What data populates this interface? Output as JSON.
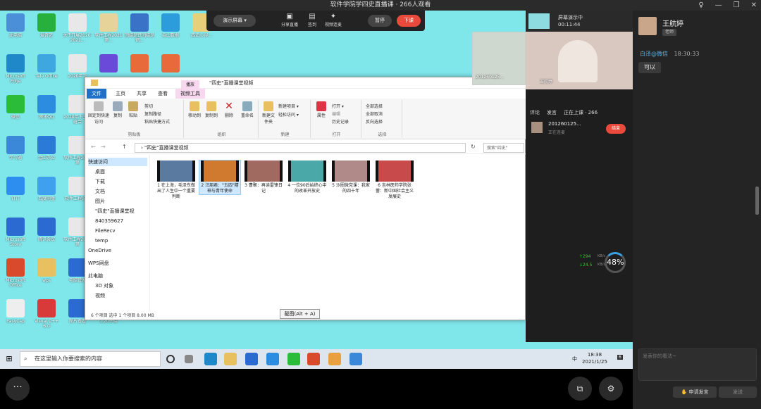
{
  "window": {
    "title": "软件学院学四史直播课 · 266人观看",
    "min": "—",
    "restore": "❐",
    "close": "✕",
    "pin": "♀"
  },
  "controlbar": {
    "projector_label": "演示屏幕 ▾",
    "tools": [
      {
        "label": "分享直播",
        "glyph": "▣"
      },
      {
        "label": "签到",
        "glyph": "▤"
      },
      {
        "label": "视频连麦",
        "glyph": "✦"
      }
    ],
    "pause": "暂停",
    "end": "下课"
  },
  "desktop": {
    "icons": [
      {
        "label": "此电脑",
        "color": "#4a8fd8"
      },
      {
        "label": "爱奇艺",
        "color": "#27b03b"
      },
      {
        "label": "关于开展2020-2021...",
        "color": "#e8e8e8"
      },
      {
        "label": "软件工程2021第...",
        "color": "#e6d39a"
      },
      {
        "label": "团结是铁团结是钢...",
        "color": "#3a72c8"
      },
      {
        "label": "金山数据",
        "color": "#2d9cdb"
      },
      {
        "label": "四史心得...",
        "color": "#e8cf7a"
      },
      {
        "label": "Microsoft Edge",
        "color": "#1e88c8"
      },
      {
        "label": "Tele Office",
        "color": "#3fa7e0"
      },
      {
        "label": "2020年下",
        "color": "#e8e8e8"
      },
      {
        "label": "",
        "color": "#6a4ad8"
      },
      {
        "label": "",
        "color": "#e86a3a"
      },
      {
        "label": "",
        "color": "#e86a3a"
      },
      {
        "label": "微信",
        "color": "#2bbd3a"
      },
      {
        "label": "腾讯QQ",
        "color": "#2b8ce0"
      },
      {
        "label": "2020年下主题班会",
        "color": "#e8e8e8"
      },
      {
        "label": "学习通",
        "color": "#3b88d8"
      },
      {
        "label": "金山办公",
        "color": "#2b7ad8"
      },
      {
        "label": "软件工程2021第",
        "color": "#e8e8e8"
      },
      {
        "label": "钉钉",
        "color": "#2d8ef0"
      },
      {
        "label": "百度网盘",
        "color": "#3fa0f0"
      },
      {
        "label": "软件工程论文",
        "color": "#e8e8e8"
      },
      {
        "label": "Microsoft Store",
        "color": "#2b6ad0"
      },
      {
        "label": "腾讯会议",
        "color": "#2b6ad0"
      },
      {
        "label": "软件工程2021第",
        "color": "#e8e8e8"
      },
      {
        "label": "Microsoft Office",
        "color": "#d84a2b"
      },
      {
        "label": "wps",
        "color": "#e8c060"
      },
      {
        "label": "电脑管家",
        "color": "#2b6ad0"
      },
      {
        "label": "EasyCap",
        "color": "#eeeeee"
      },
      {
        "label": "Visual C++ 6.0",
        "color": "#d83a3a"
      },
      {
        "label": "图片查看",
        "color": "#2b6ad0"
      },
      {
        "label": "1.20王晓",
        "color": "#e8c060"
      }
    ]
  },
  "explorer": {
    "window_title": "\"四史\"直播课堂视频",
    "tabs": [
      "文件",
      "主页",
      "共享",
      "查看",
      "视频工具",
      "播放"
    ],
    "ribbon": {
      "clipboard": {
        "label": "剪贴板",
        "pin": "固定到快速访问",
        "copy": "复制",
        "paste": "粘贴",
        "cut": "剪切",
        "copy_path": "复制路径",
        "paste_shortcut": "粘贴快捷方式"
      },
      "organize": {
        "label": "组织",
        "move": "移动到",
        "copy_to": "复制到",
        "delete": "删除",
        "rename": "重命名"
      },
      "new": {
        "label": "新建",
        "folder": "新建文件夹",
        "item": "新建项目 ▾",
        "easy_access": "轻松访问 ▾"
      },
      "open": {
        "label": "打开",
        "properties": "属性",
        "open": "打开 ▾",
        "edit": "编辑",
        "history": "历史记录"
      },
      "select": {
        "label": "选择",
        "all": "全部选择",
        "none": "全部取消",
        "invert": "反向选择"
      }
    },
    "address": "› \"四史\"直播课堂视频",
    "search_placeholder": "搜索\"四史\"",
    "nav": [
      "快速访问",
      "桌面",
      "下载",
      "文档",
      "图片",
      "\"四史\"直播课堂视",
      "840359627",
      "FileRecv",
      "temp",
      "OneDrive",
      "WPS网盘",
      "此电脑",
      "3D 对象",
      "视频"
    ],
    "files": [
      {
        "name": "1 在上海，毛泽东做出了人生中一个重要判断",
        "color": "#5a7aa0"
      },
      {
        "name": "2 汪朋君：\"五四\"精神与青年使命",
        "color": "#d07a30"
      },
      {
        "name": "3 曹聚：再读雷锋日记",
        "color": "#a06a60"
      },
      {
        "name": "4 一位90后始终心中的改革开放史",
        "color": "#4aa8a8"
      },
      {
        "name": "5 沙圈微党课：我家的四十年",
        "color": "#b08a88"
      },
      {
        "name": "6 吉林医药学院张蕾：新中国社会主义发展史",
        "color": "#c84a4a"
      }
    ],
    "status": "6 个项目    选中 1 个项目  8.00 MB"
  },
  "tooltip": "截图(Alt + A)",
  "meeting": {
    "share_status": "屏幕演示中",
    "share_time": "00:11:44",
    "student_caption": "201260125...",
    "teacher_caption": "王航婷",
    "tabs": [
      "评论",
      "发言",
      "正在上课 · 266"
    ],
    "speaker_id": "201260125...",
    "speaker_status": "正在连麦",
    "end_call": "结束",
    "net_up": "↑294",
    "net_down": "↓24.5",
    "net_unit": "KB/s",
    "percent": "48%"
  },
  "chat": {
    "name": "王航婷",
    "badge": "老师",
    "sender": "白泽@微信",
    "time": "18:30:33",
    "message": "可以",
    "input_placeholder": "发表你的看法~",
    "apply_speak": "申请发言",
    "send": "发送"
  },
  "taskbar": {
    "start": "⊞",
    "search_placeholder": "在这里输入你要搜索的内容",
    "time": "18:38",
    "date": "2021/1/25",
    "ime": "中",
    "tray_count": "6"
  },
  "bottombar": {
    "more": "···",
    "share": "⧉",
    "settings": "⚙"
  }
}
